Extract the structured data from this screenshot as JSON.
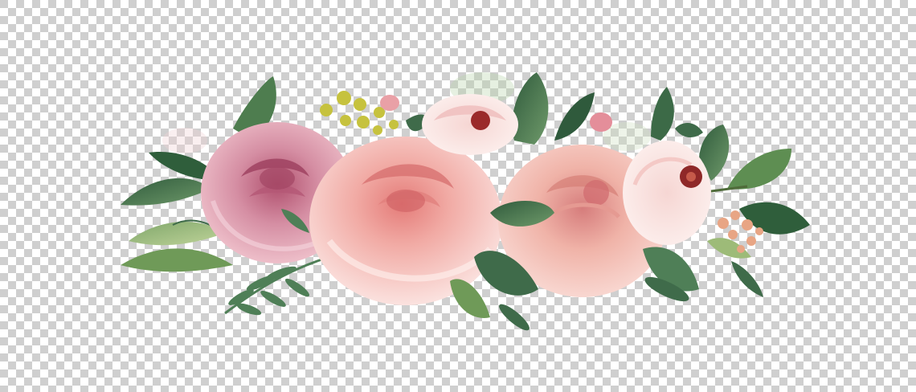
{
  "image": {
    "subject": "watercolor-rose-bouquet",
    "background": {
      "pattern": "transparency-checkerboard",
      "light": "#ffffff",
      "dark": "#cfcfcf"
    },
    "palette": {
      "rose_pink": "#f3b8b2",
      "rose_deep": "#c46a86",
      "rose_blush": "#f7d2cf",
      "leaf_dark": "#3f6b4a",
      "leaf_mid": "#5e8a5a",
      "leaf_light": "#9bb87a",
      "berry_yellow": "#c8c84a",
      "flower_center": "#9b2a2a"
    },
    "elements": [
      "rose-mauve-left",
      "rose-pink-center",
      "rose-peach-right",
      "peony-bud-top",
      "anemone-white-right",
      "leaf-clusters",
      "yellow-berries",
      "peach-filler-flowers"
    ]
  }
}
